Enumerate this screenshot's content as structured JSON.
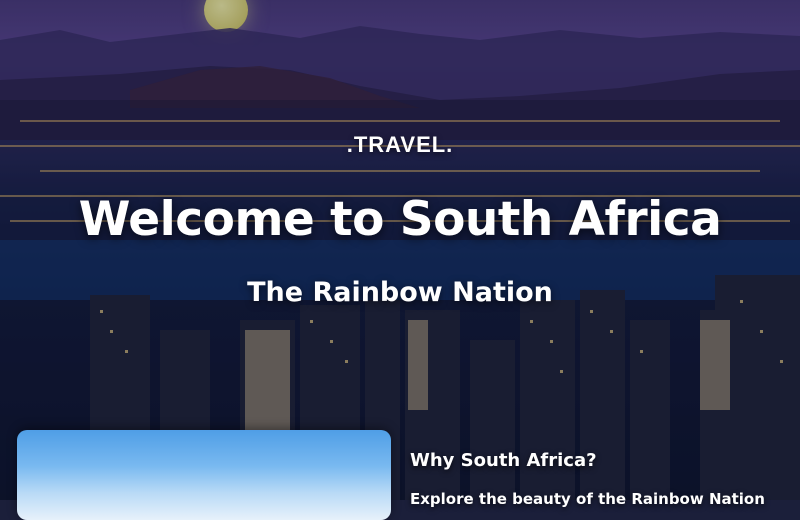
{
  "hero": {
    "brand": ".TRAVEL.",
    "headline": "Welcome to South Africa",
    "subheadline": "The Rainbow Nation"
  },
  "intro": {
    "title": "Why South Africa?",
    "text": "Explore the beauty of the Rainbow Nation"
  },
  "colors": {
    "sky": "#4a3a7a",
    "city_lights": "#f2c46a",
    "text": "#ffffff"
  }
}
